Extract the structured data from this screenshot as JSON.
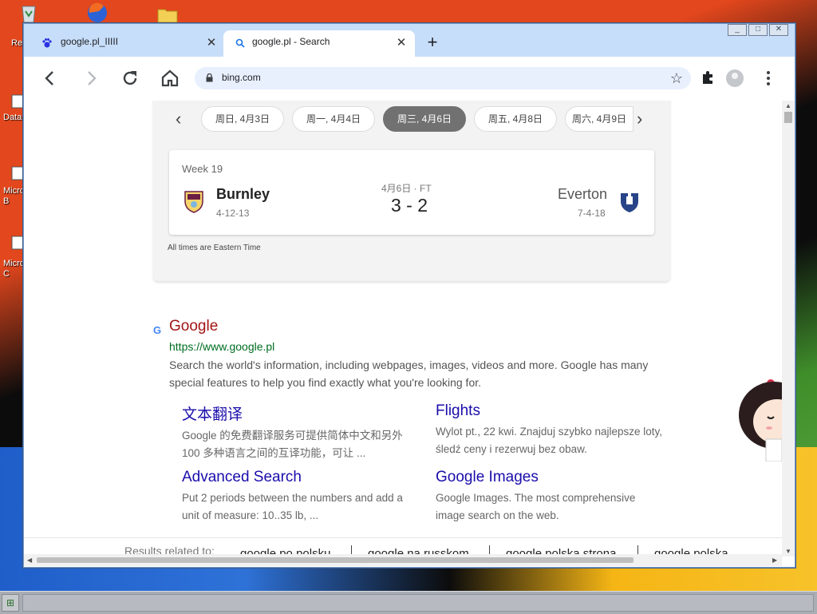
{
  "desktop": {
    "icons": [
      {
        "name": "recycle-bin-icon",
        "label": "Re"
      },
      {
        "name": "firefox-icon",
        "label": ""
      },
      {
        "name": "folder-icon",
        "label": ""
      },
      {
        "name": "data-file-icon",
        "label": "Data"
      },
      {
        "name": "microsoft-b-icon",
        "label": "Micro\nB"
      },
      {
        "name": "microsoft-c-icon",
        "label": "Micro\nC"
      }
    ]
  },
  "browser": {
    "tabs": [
      {
        "title": "google.pl_IIIII",
        "icon": "baidu-paw-icon",
        "active": false
      },
      {
        "title": "google.pl - Search",
        "icon": "search-icon",
        "active": true
      }
    ],
    "new_tab_label": "+",
    "url": "bing.com",
    "window_buttons": [
      "_",
      "□",
      "✕"
    ]
  },
  "sports_card": {
    "dates": [
      {
        "label": "周日, 4月3日",
        "active": false
      },
      {
        "label": "周一, 4月4日",
        "active": false
      },
      {
        "label": "周三, 4月6日",
        "active": true
      },
      {
        "label": "周五, 4月8日",
        "active": false
      },
      {
        "label": "周六, 4月9日",
        "active": false
      }
    ],
    "match": {
      "week": "Week 19",
      "home_team": "Burnley",
      "home_record": "4-12-13",
      "away_team": "Everton",
      "away_record": "7-4-18",
      "date_status": "4月6日 · FT",
      "score": "3 - 2"
    },
    "timezone_note": "All times are Eastern Time"
  },
  "result": {
    "title": "Google",
    "url": "https://www.google.pl",
    "snippet": "Search the world's information, including webpages, images, videos and more. Google has many special features to help you find exactly what you're looking for.",
    "sublinks": [
      {
        "title": "文本翻译",
        "desc": "Google 的免费翻译服务可提供简体中文和另外 100 多种语言之间的互译功能，可让 ..."
      },
      {
        "title": "Flights",
        "desc": "Wylot pt., 22 kwi. Znajduj szybko najlepsze loty, śledź ceny i rezerwuj bez obaw."
      },
      {
        "title": "Advanced Search",
        "desc": "Put 2 periods between the numbers and add a unit of measure: 10..35 lb, ..."
      },
      {
        "title": "Google Images",
        "desc": "Google Images. The most comprehensive image search on the web."
      }
    ]
  },
  "related": {
    "label": "Results related to:",
    "items": [
      "google po polsku",
      "google na russkom",
      "google polska strona",
      "google polska"
    ]
  },
  "colors": {
    "tabstrip": "#c7defa",
    "result_title": "#a31515",
    "result_url": "#006d21",
    "sublink": "#1a0dab",
    "active_pill": "#717171"
  }
}
